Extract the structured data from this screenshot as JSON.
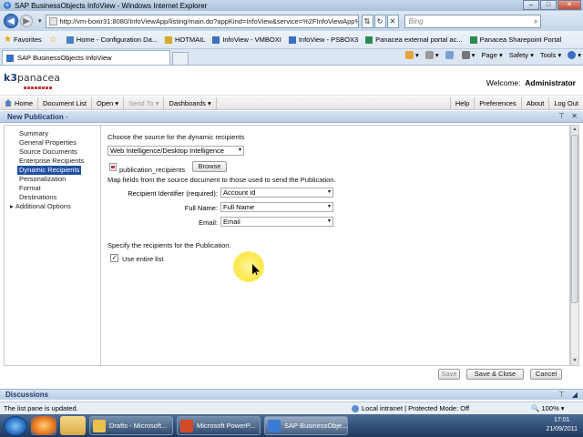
{
  "window": {
    "title": "SAP BusinessObjects InfoView - Windows Internet Explorer"
  },
  "address": {
    "url": "http://vm-boxir31:8080/InfoViewApp/listing/main.do?appKind=InfoView&service=%2FInfoViewApp%",
    "search_placeholder": "Bing"
  },
  "favorites": {
    "label": "Favorites",
    "items": [
      "Home - Configuration Da...",
      "HOTMAIL",
      "InfoView - VMBOXI",
      "InfoView - PSBOX3",
      "Panacea external portal ac...",
      "Panacea Sharepoint Portal"
    ]
  },
  "tab": {
    "label": "SAP BusinessObjects InfoView"
  },
  "commandbar": {
    "page": "Page",
    "safety": "Safety",
    "tools": "Tools"
  },
  "header": {
    "logo_text": "panacea",
    "logo_prefix": "k3",
    "welcome_label": "Welcome:",
    "user": "Administrator"
  },
  "toolbar": {
    "home": "Home",
    "document_list": "Document List",
    "open": "Open",
    "send_to": "Send To",
    "dashboards": "Dashboards",
    "help": "Help",
    "preferences": "Preferences",
    "about": "About",
    "logout": "Log Out"
  },
  "panel": {
    "title": "New Publication"
  },
  "nav": {
    "items": [
      "Summary",
      "General Properties",
      "Source Documents",
      "Enterprise Recipients",
      "Dynamic Recipients",
      "Personalization",
      "Format",
      "Destinations"
    ],
    "additional": "Additional Options"
  },
  "main": {
    "choose_source": "Choose the source for the dynamic recipients",
    "source_value": "Web Intelligence/Desktop Intelligence",
    "file_name": "publication_recipients",
    "browse": "Browse",
    "map_fields": "Map fields from the source document to those used to send the Publication.",
    "fields": [
      {
        "label": "Recipient Identifier (required):",
        "value": "Account Id"
      },
      {
        "label": "Full Name:",
        "value": "Full Name"
      },
      {
        "label": "Email:",
        "value": "Email"
      }
    ],
    "specify": "Specify the recipients for the Publication.",
    "use_entire_list": "Use entire list",
    "use_entire_list_checked": true,
    "save": "Save",
    "save_close": "Save & Close",
    "cancel": "Cancel"
  },
  "discussions": {
    "label": "Discussions"
  },
  "status": {
    "message": "The list pane is updated.",
    "zone": "Local intranet | Protected Mode: Off",
    "zoom": "100%"
  },
  "taskbar": {
    "tasks": [
      "Drafts - Microsoft...",
      "Microsoft PowerP...",
      "SAP BusinessObje..."
    ],
    "time": "17:01",
    "date": "21/09/2011"
  }
}
